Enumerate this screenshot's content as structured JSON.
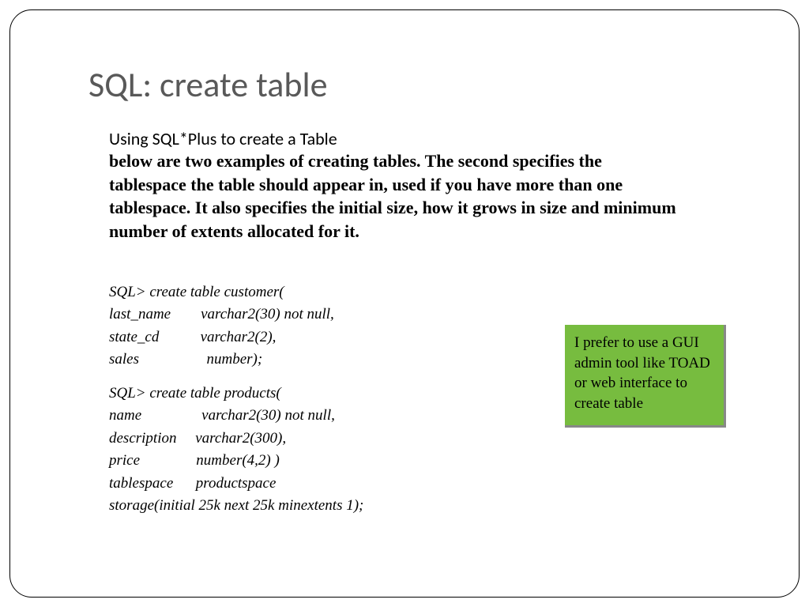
{
  "title": "SQL:  create table",
  "subtitle": "Using SQL*Plus to create a Table",
  "description": "below are two examples of creating tables. The second specifies the tablespace the table should appear in, used if you have more than one tablespace. It also specifies the initial size, how it grows in size and minimum number of extents allocated for it.",
  "code1": "SQL> create table customer(\nlast_name        varchar2(30) not null,\nstate_cd           varchar2(2),\nsales                  number);",
  "code2": "SQL> create table products(\nname                varchar2(30) not null,\ndescription     varchar2(300),\nprice               number(4,2) )\ntablespace      productspace\nstorage(initial 25k next 25k minextents 1);",
  "callout": "I prefer to use a GUI admin tool like TOAD or web interface to create table"
}
